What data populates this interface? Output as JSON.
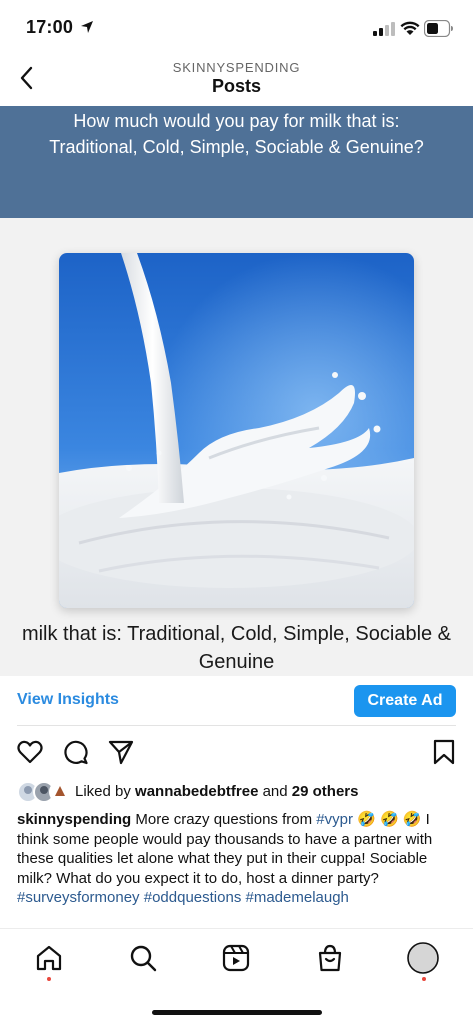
{
  "status_bar": {
    "time": "17:00",
    "icons": [
      "location-arrow-icon",
      "signal-icon",
      "wifi-icon",
      "battery-icon"
    ]
  },
  "header": {
    "account": "SKINNYSPENDING",
    "title": "Posts",
    "back_icon": "chevron-left-icon"
  },
  "post": {
    "banner_text": "How much would you pay for milk that is: Traditional, Cold, Simple, Sociable & Genuine?",
    "image_caption": "milk that is: Traditional, Cold, Simple, Sociable & Genuine",
    "image_subject": "milk-splash-image",
    "view_insights": "View Insights",
    "create_ad": "Create Ad",
    "actions": [
      "heart-icon",
      "comment-icon",
      "share-icon",
      "bookmark-icon"
    ],
    "likes": {
      "prefix": "Liked by",
      "user": "wannabedebtfree",
      "joiner": "and",
      "others": "29 others"
    },
    "caption": {
      "username": "skinnyspending",
      "text_1": "More crazy questions from",
      "tag_1": "#vypr",
      "text_2": "🤣 🤣 🤣 I think some people would pay thousands to have a partner with these qualities let alone what they put in their cuppa! Sociable milk? What do you expect it to do, host a dinner party?",
      "tag_2": "#surveysformoney",
      "tag_3": "#oddquestions",
      "tag_4": "#mademelaugh"
    }
  },
  "tabbar": {
    "tabs": [
      "home-icon",
      "search-icon",
      "reels-icon",
      "shop-icon",
      "profile-avatar"
    ]
  },
  "colors": {
    "banner": "#4f7197",
    "accent": "#1b95ef",
    "link": "#2b8be0",
    "hashtag": "#2c5a8f",
    "notification_dot": "#e8473c"
  }
}
